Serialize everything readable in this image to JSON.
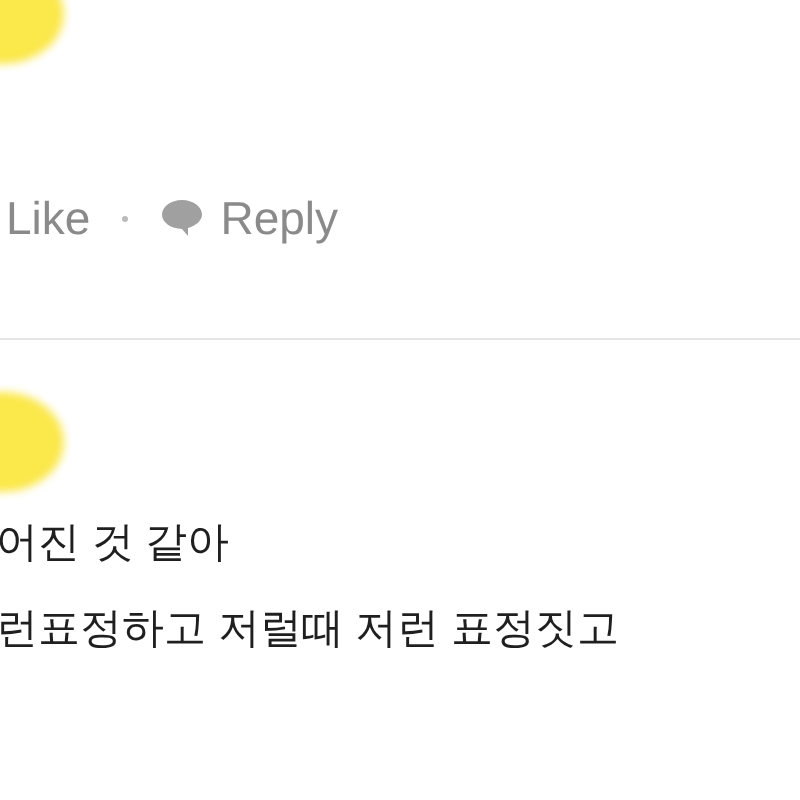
{
  "comments": [
    {
      "actions": [
        {
          "kind": "like",
          "label": "Like"
        },
        {
          "kind": "reply",
          "label": "Reply"
        }
      ]
    },
    {
      "lines": [
        "어진 것 같아",
        "런표정하고 저럴때 저런 표정짓고"
      ]
    }
  ]
}
